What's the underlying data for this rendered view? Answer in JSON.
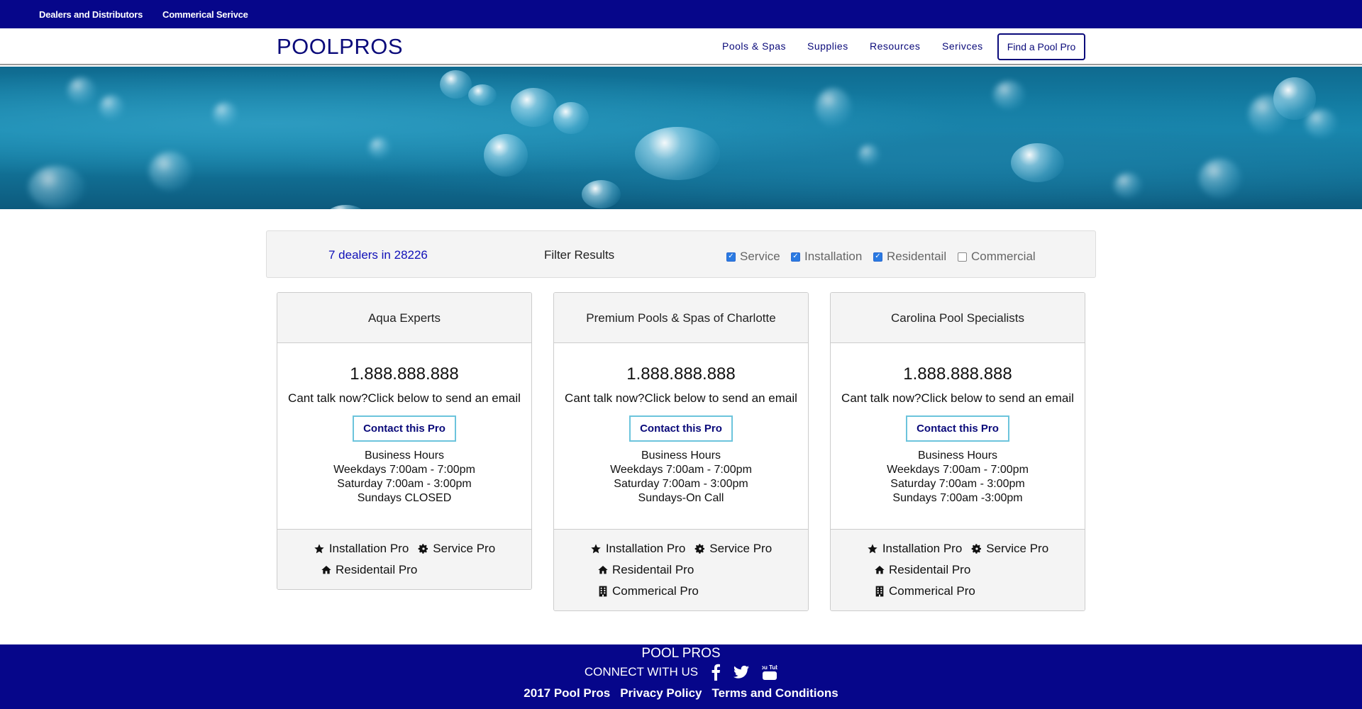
{
  "topbar": {
    "links": [
      "Dealers and Distributors",
      "Commerical Serivce"
    ]
  },
  "nav": {
    "logo": "POOLPROS",
    "links": [
      "Pools & Spas",
      "Supplies",
      "Resources",
      "Serivces"
    ],
    "cta": "Find a Pool Pro"
  },
  "filter": {
    "count": "7 dealers in 28226",
    "label": "Filter Results",
    "options": [
      {
        "label": "Service",
        "checked": true
      },
      {
        "label": "Installation",
        "checked": true
      },
      {
        "label": "Residentail",
        "checked": true
      },
      {
        "label": "Commercial",
        "checked": false
      }
    ]
  },
  "dealers": [
    {
      "name": "Aqua Experts",
      "phone": "1.888.888.888",
      "cant_talk": "Cant talk now?Click below to send an email",
      "contact": "Contact this Pro",
      "hours_title": "Business Hours",
      "weekdays": "Weekdays 7:00am - 7:00pm",
      "saturday": "Saturday 7:00am - 3:00pm",
      "sunday": "Sundays CLOSED",
      "tags": {
        "installation": "Installation Pro",
        "service": "Service Pro",
        "residential": "Residentail Pro"
      }
    },
    {
      "name": "Premium Pools & Spas of Charlotte",
      "phone": "1.888.888.888",
      "cant_talk": "Cant talk now?Click below to send an email",
      "contact": "Contact this Pro",
      "hours_title": "Business Hours",
      "weekdays": "Weekdays 7:00am - 7:00pm",
      "saturday": "Saturday 7:00am - 3:00pm",
      "sunday": "Sundays-On Call",
      "tags": {
        "installation": "Installation Pro",
        "service": "Service Pro",
        "residential": "Residentail Pro",
        "commercial": "Commerical Pro"
      }
    },
    {
      "name": "Carolina Pool Specialists",
      "phone": "1.888.888.888",
      "cant_talk": "Cant talk now?Click below to send an email",
      "contact": "Contact this Pro",
      "hours_title": "Business Hours",
      "weekdays": "Weekdays 7:00am - 7:00pm",
      "saturday": "Saturday 7:00am - 3:00pm",
      "sunday": "Sundays 7:00am -3:00pm",
      "tags": {
        "installation": "Installation Pro",
        "service": "Service Pro",
        "residential": "Residentail Pro",
        "commercial": "Commerical Pro"
      }
    }
  ],
  "footer": {
    "title": "POOL PROS",
    "connect": "CONNECT WITH US",
    "social_icons": [
      "facebook-icon",
      "twitter-icon",
      "youtube-icon"
    ],
    "youtube_text": "You Tube",
    "links": [
      "2017 Pool Pros",
      "Privacy Policy",
      "Terms and Conditions"
    ]
  },
  "colors": {
    "navy": "#06068a",
    "accent": "#6cc4dc",
    "checkbox": "#2a7ae2",
    "count": "#1010b8"
  }
}
